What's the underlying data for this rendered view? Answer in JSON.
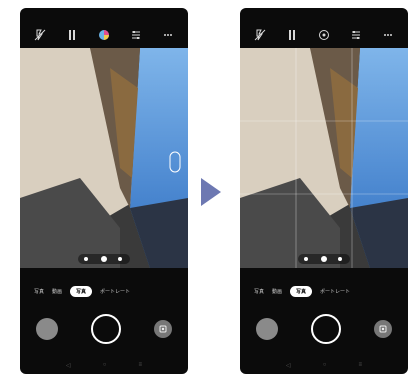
{
  "left_phone": {
    "modes": [
      "写真",
      "動画",
      "写真",
      "ポートレート"
    ],
    "active_mode_index": 2,
    "grid_shown": false
  },
  "right_phone": {
    "modes": [
      "写真",
      "動画",
      "写真",
      "ポートレート"
    ],
    "active_mode_index": 2,
    "grid_shown": true
  },
  "icons": {
    "top": [
      "flash-off-icon",
      "hdr-icon",
      "filter-color-icon",
      "settings-adjust-icon",
      "more-icon"
    ],
    "bottom": [
      "gallery-thumbnail",
      "shutter-button",
      "switch-camera-icon"
    ],
    "nav": [
      "back-icon",
      "home-icon",
      "recents-icon"
    ]
  },
  "colors": {
    "arrow": "#6d78b2",
    "sky": "#4a86c8",
    "phone_body": "#0b0b0b"
  }
}
